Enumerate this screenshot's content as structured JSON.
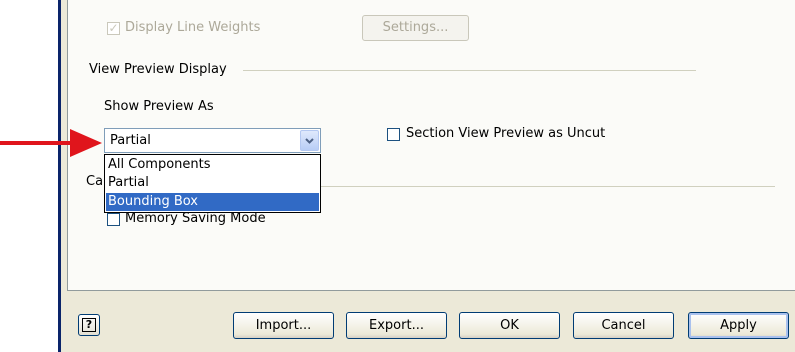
{
  "top": {
    "line_weights_checkbox_label": "Display Line Weights",
    "settings_button": "Settings..."
  },
  "view_preview": {
    "group_title": "View Preview Display",
    "show_preview_label": "Show Preview As",
    "selected_value": "Partial",
    "options": [
      "All Components",
      "Partial",
      "Bounding Box"
    ],
    "highlighted_option": "Bounding Box",
    "section_view_label": "Section View Preview as Uncut"
  },
  "capacity": {
    "group_title_partial": "Ca",
    "memory_saving_label": "Memory Saving Mode"
  },
  "footer": {
    "help_icon": "?",
    "import_button": "Import...",
    "export_button": "Export...",
    "ok_button": "OK",
    "cancel_button": "Cancel",
    "apply_button": "Apply"
  },
  "annotation": {
    "arrow_color": "#e0151c"
  }
}
